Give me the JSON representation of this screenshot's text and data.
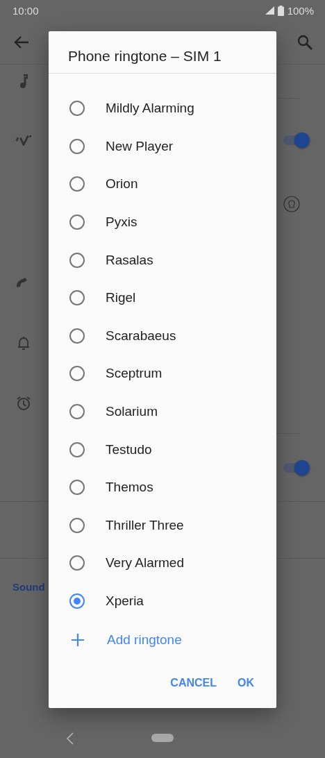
{
  "status_bar": {
    "time": "10:00",
    "battery": "100%"
  },
  "background": {
    "toggles": [
      {
        "on": true
      },
      {
        "on": true
      }
    ],
    "section_label": "Sound"
  },
  "dialog": {
    "title": "Phone ringtone – SIM 1",
    "items": [
      {
        "label": "Mildly Alarming",
        "selected": false
      },
      {
        "label": "New Player",
        "selected": false
      },
      {
        "label": "Orion",
        "selected": false
      },
      {
        "label": "Pyxis",
        "selected": false
      },
      {
        "label": "Rasalas",
        "selected": false
      },
      {
        "label": "Rigel",
        "selected": false
      },
      {
        "label": "Scarabaeus",
        "selected": false
      },
      {
        "label": "Sceptrum",
        "selected": false
      },
      {
        "label": "Solarium",
        "selected": false
      },
      {
        "label": "Testudo",
        "selected": false
      },
      {
        "label": "Themos",
        "selected": false
      },
      {
        "label": "Thriller Three",
        "selected": false
      },
      {
        "label": "Very Alarmed",
        "selected": false
      },
      {
        "label": "Xperia",
        "selected": true
      }
    ],
    "add_action": "Add ringtone",
    "buttons": [
      "CANCEL",
      "OK"
    ]
  }
}
